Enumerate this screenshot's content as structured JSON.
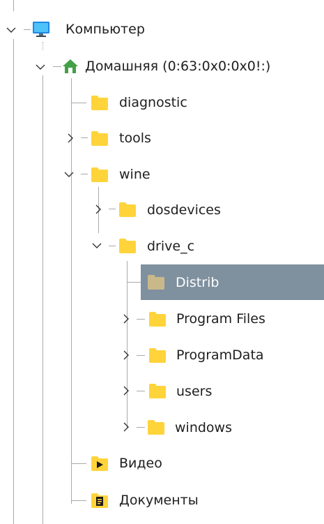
{
  "tree": {
    "items": [
      {
        "label": "Компьютер",
        "icon": "computer-icon",
        "expanded": true
      },
      {
        "label": "Домашняя (0:63:0x0:0x0!:)",
        "icon": "home-icon",
        "expanded": true
      },
      {
        "label": "diagnostic",
        "icon": "folder-icon",
        "expanded": null
      },
      {
        "label": "tools",
        "icon": "folder-icon",
        "expanded": false
      },
      {
        "label": "wine",
        "icon": "folder-icon",
        "expanded": true
      },
      {
        "label": "dosdevices",
        "icon": "folder-icon",
        "expanded": false
      },
      {
        "label": "drive_c",
        "icon": "folder-icon",
        "expanded": true
      },
      {
        "label": "Distrib",
        "icon": "folder-icon",
        "expanded": null,
        "selected": true
      },
      {
        "label": "Program Files",
        "icon": "folder-icon",
        "expanded": false
      },
      {
        "label": "ProgramData",
        "icon": "folder-icon",
        "expanded": false
      },
      {
        "label": "users",
        "icon": "folder-icon",
        "expanded": false
      },
      {
        "label": "windows",
        "icon": "folder-icon",
        "expanded": false
      },
      {
        "label": "Видео",
        "icon": "video-folder-icon",
        "expanded": null
      },
      {
        "label": "Документы",
        "icon": "documents-folder-icon",
        "expanded": null
      }
    ]
  },
  "colors": {
    "selection": "#7f909f",
    "folder": "#ffd43b",
    "computer": "#2aa0e8",
    "home": "#4caf50",
    "tree_lines": "#a9a9a9"
  }
}
